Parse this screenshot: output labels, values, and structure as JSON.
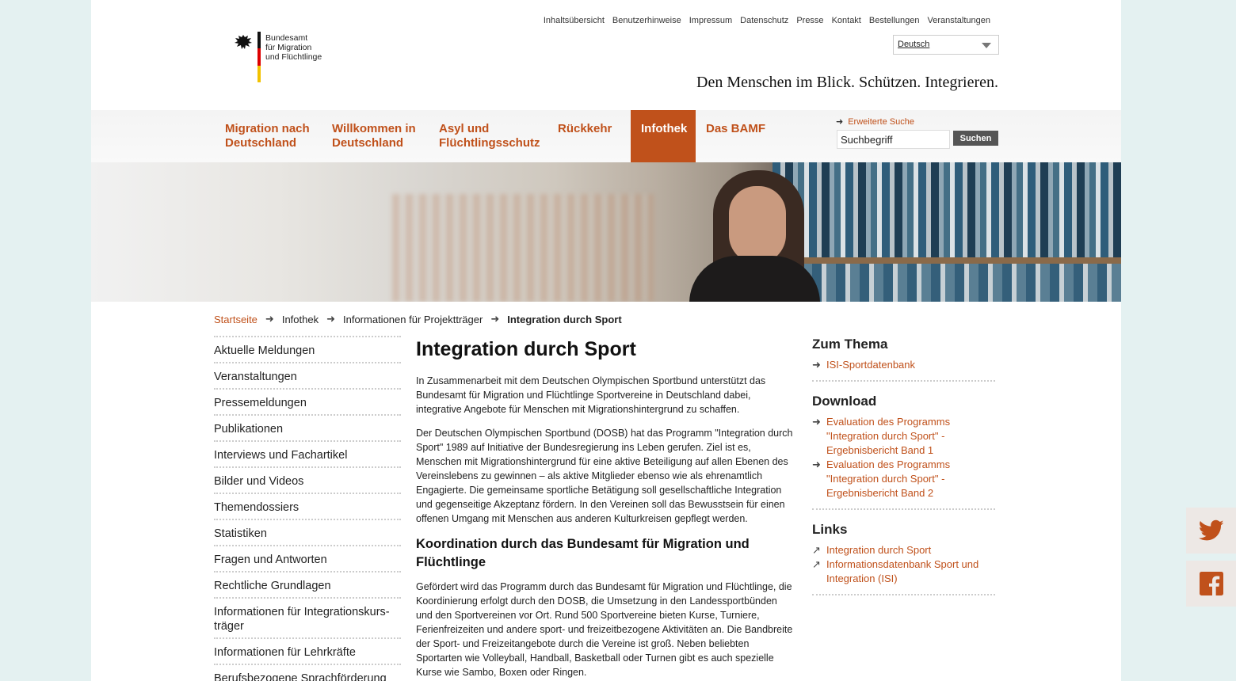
{
  "meta_nav": [
    "Inhaltsübersicht",
    "Benutzerhinweise",
    "Impressum",
    "Datenschutz",
    "Presse",
    "Kontakt",
    "Bestellungen",
    "Veranstaltungen"
  ],
  "logo": {
    "line1": "Bundesamt",
    "line2": "für Migration",
    "line3": "und Flüchtlinge"
  },
  "language": {
    "selected": "Deutsch"
  },
  "slogan": "Den Menschen im Blick. Schützen. Integrieren.",
  "main_nav": [
    {
      "line1": "Migration nach",
      "line2": "Deutschland"
    },
    {
      "line1": "Willkommen in",
      "line2": "Deutschland"
    },
    {
      "line1": "Asyl und",
      "line2": "Flüchtlingsschutz"
    },
    {
      "line1": "Rückkehr",
      "line2": ""
    },
    {
      "line1": "Infothek",
      "line2": ""
    },
    {
      "line1": "Das BAMF",
      "line2": ""
    }
  ],
  "search": {
    "advanced_label": "Erweiterte Suche",
    "value": "Suchbegriff",
    "button": "Suchen"
  },
  "breadcrumb": {
    "home": "Startseite",
    "level1": "Infothek",
    "level2": "Informationen für Projektträger",
    "current": "Integration durch Sport"
  },
  "sidebar": [
    "Aktuelle Meldungen",
    "Veranstaltungen",
    "Pressemeldungen",
    "Publikationen",
    "Interviews und Fachartikel",
    "Bilder und Videos",
    "Themendossiers",
    "Statistiken",
    "Fragen und Antworten",
    "Rechtliche Grundlagen",
    "Informationen für Integrationskurs-träger",
    "Informationen für Lehrkräfte",
    "Berufsbezogene Sprachförderung"
  ],
  "article": {
    "title": "Integration durch Sport",
    "p1": "In Zusammenarbeit mit dem Deutschen Olympischen Sportbund unterstützt das Bundesamt für Migration und Flüchtlinge Sportvereine in Deutschland dabei, integrative Angebote für Menschen mit Migrationshintergrund zu schaffen.",
    "p2": "Der Deutschen Olympischen Sportbund (DOSB) hat das Programm \"Integration durch Sport\" 1989 auf Initiative der Bundesregierung ins Leben gerufen. Ziel ist es, Menschen mit Migrationshintergrund für eine aktive Beteiligung auf allen Ebenen des Vereinslebens zu gewinnen – als aktive Mitglieder ebenso wie als ehrenamtlich Engagierte. Die gemeinsame sportliche Betätigung soll gesellschaftliche Integration und gegenseitige Akzeptanz fördern. In den Vereinen soll das Bewusstsein für einen offenen Umgang mit Menschen aus anderen Kulturkreisen gepflegt werden.",
    "h2": "Koordination durch das Bundesamt für Migration und Flüchtlinge",
    "p3": "Gefördert wird das Programm durch das Bundesamt für Migration und Flüchtlinge, die Koordinierung erfolgt durch den DOSB, die Umsetzung in den Landessportbünden und den Sportvereinen vor Ort. Rund 500 Sportvereine bieten Kurse, Turniere, Ferienfreizeiten und andere sport- und freizeitbezogene Aktivitäten an. Die Bandbreite der Sport- und Freizeitangebote durch die Vereine ist groß. Neben beliebten Sportarten wie Volleyball, Handball, Basketball oder Turnen gibt es auch spezielle Kurse wie Sambo, Boxen oder Ringen."
  },
  "right": {
    "thema_title": "Zum Thema",
    "thema_links": [
      "ISI-Sportdatenbank"
    ],
    "download_title": "Download",
    "download_links": [
      "Evaluation des Programms \"Integration durch Sport\" - Ergebnisbericht Band 1",
      "Evaluation des Programms \"Integration durch Sport\" - Ergebnisbericht Band 2"
    ],
    "links_title": "Links",
    "external_links": [
      "Integration durch Sport",
      "Informationsdatenbank Sport und Integration (ISI)"
    ]
  },
  "colors": {
    "accent": "#c0511b",
    "page_bg": "#e4f1f1",
    "social_bg": "#ede8e5"
  },
  "icons": {
    "social": [
      "twitter-icon",
      "facebook-icon"
    ]
  }
}
